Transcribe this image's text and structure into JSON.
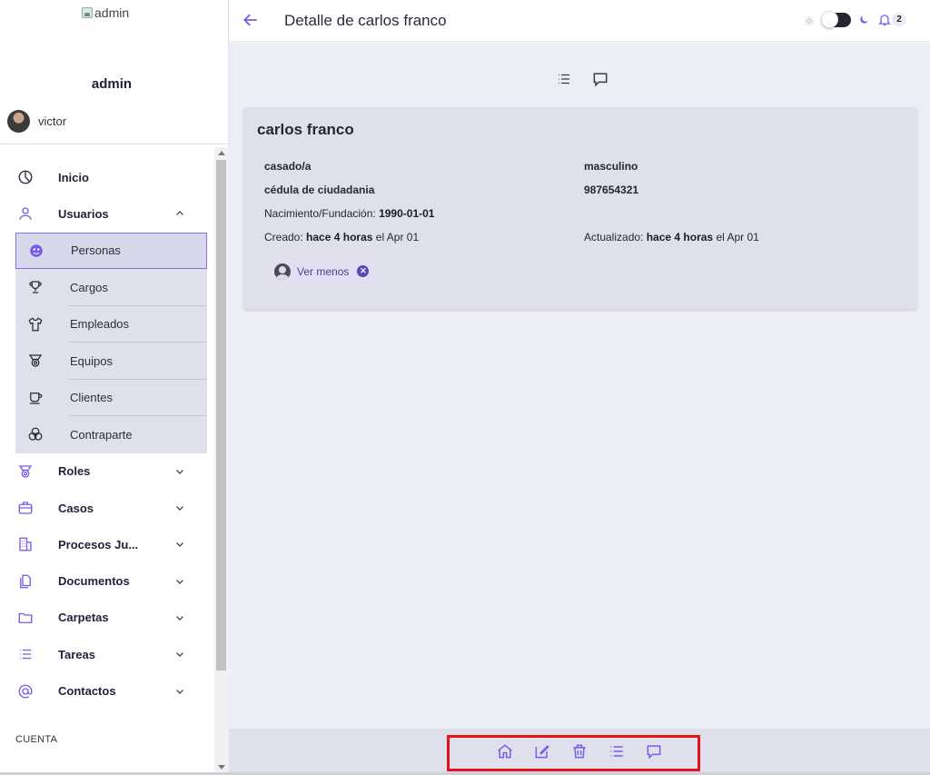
{
  "sidebar": {
    "logo_alt": "admin",
    "name": "admin",
    "user": "victor",
    "nav": [
      {
        "label": "Inicio",
        "icon": "pie-chart-icon"
      },
      {
        "label": "Usuarios",
        "icon": "user-icon",
        "expanded": true,
        "children": [
          {
            "label": "Personas",
            "icon": "face-icon",
            "active": true
          },
          {
            "label": "Cargos",
            "icon": "trophy-icon"
          },
          {
            "label": "Empleados",
            "icon": "shirt-icon"
          },
          {
            "label": "Equipos",
            "icon": "medal-icon"
          },
          {
            "label": "Clientes",
            "icon": "cup-icon"
          },
          {
            "label": "Contraparte",
            "icon": "circles-icon"
          }
        ]
      },
      {
        "label": "Roles",
        "icon": "medal-icon"
      },
      {
        "label": "Casos",
        "icon": "briefcase-icon"
      },
      {
        "label": "Procesos Ju...",
        "icon": "building-icon"
      },
      {
        "label": "Documentos",
        "icon": "files-icon"
      },
      {
        "label": "Carpetas",
        "icon": "folder-icon"
      },
      {
        "label": "Tareas",
        "icon": "list-icon"
      },
      {
        "label": "Contactos",
        "icon": "at-icon"
      }
    ],
    "section": "CUENTA"
  },
  "header": {
    "title": "Detalle de carlos franco",
    "notifications": "2",
    "dark_mode": false
  },
  "card": {
    "name": "carlos franco",
    "civil_status": "casado/a",
    "gender": "masculino",
    "doc_type": "cédula de ciudadania",
    "doc_number": "987654321",
    "birth_label": "Nacimiento/Fundación:",
    "birth_value": "1990-01-01",
    "created_label": "Creado:",
    "created_value": "hace 4 horas",
    "created_date": "el Apr 01",
    "updated_label": "Actualizado:",
    "updated_value": "hace 4 horas",
    "updated_date": "el Apr 01",
    "chip_label": "Ver menos"
  },
  "bottom_toolbar": {
    "icons": [
      "home-icon",
      "edit-icon",
      "trash-icon",
      "list-icon",
      "comment-icon"
    ]
  },
  "colors": {
    "accent": "#7a5ae6",
    "highlight": "#e4111b",
    "panel": "#dfe0ec",
    "background": "#edeef5"
  }
}
